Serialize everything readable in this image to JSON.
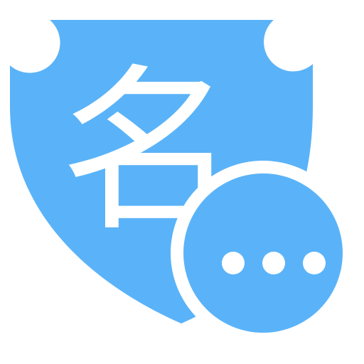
{
  "icon": {
    "name": "name-shield-more-icon",
    "shield_glyph": "名",
    "badge": "more-dots-icon"
  },
  "colors": {
    "shield_fill": "#5ab3f8",
    "glyph_color": "#ffffff",
    "badge_fill": "#5ab3f8",
    "badge_ring": "#ffffff",
    "dot_color": "#ffffff",
    "background": "#ffffff"
  }
}
